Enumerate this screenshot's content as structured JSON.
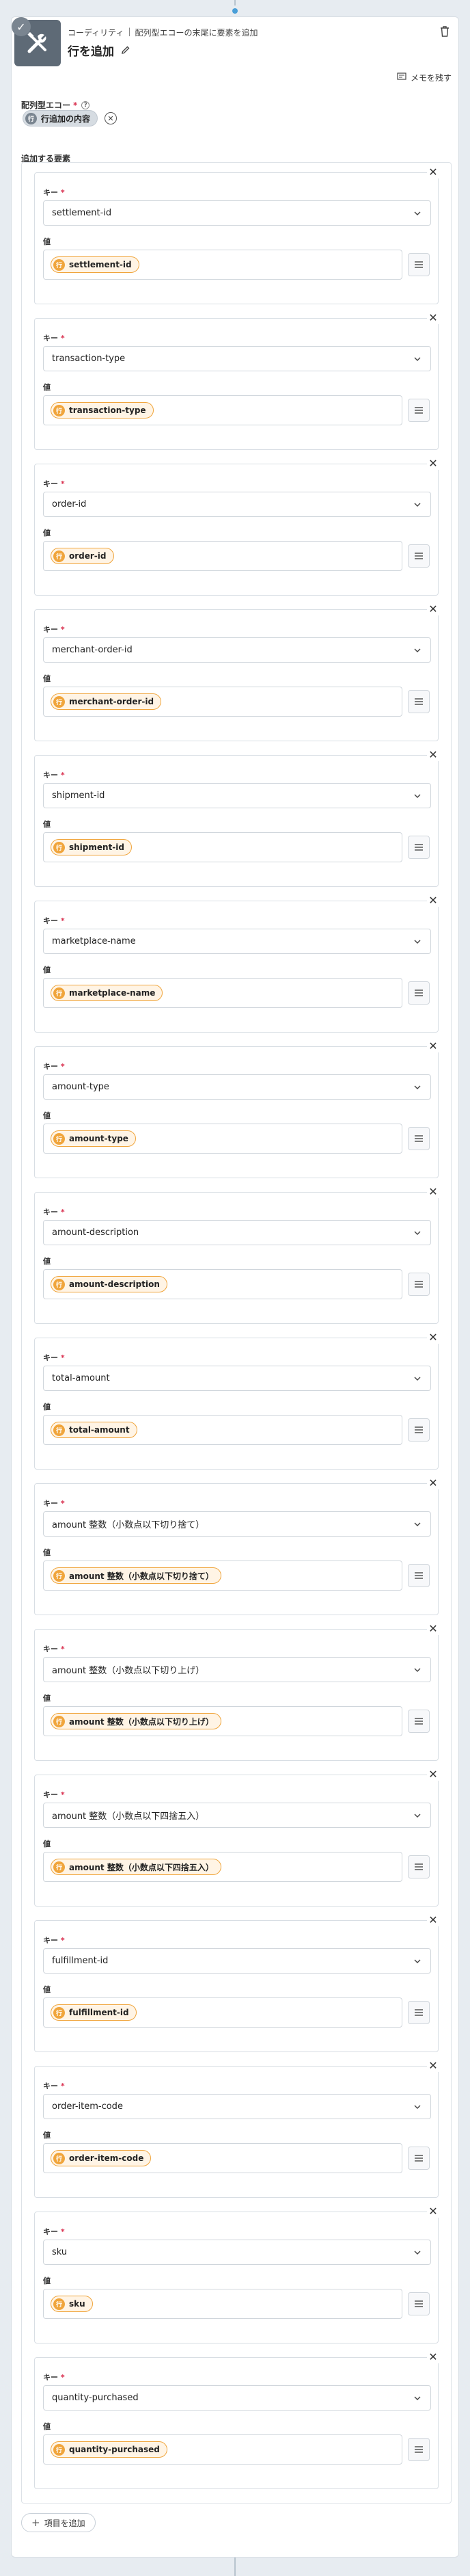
{
  "header": {
    "breadcrumb_app": "コーディリティ",
    "breadcrumb_action": "配列型エコーの末尾に要素を追加",
    "title": "行を追加",
    "memo_label": "メモを残す"
  },
  "source": {
    "label": "配列型エコー",
    "badge": "行",
    "pill": "行追加の内容"
  },
  "elements": {
    "label": "追加する要素",
    "key_label": "キー",
    "value_label": "値",
    "badge": "行",
    "items": [
      {
        "key": "settlement-id",
        "value": "settlement-id"
      },
      {
        "key": "transaction-type",
        "value": "transaction-type"
      },
      {
        "key": "order-id",
        "value": "order-id"
      },
      {
        "key": "merchant-order-id",
        "value": "merchant-order-id"
      },
      {
        "key": "shipment-id",
        "value": "shipment-id"
      },
      {
        "key": "marketplace-name",
        "value": "marketplace-name"
      },
      {
        "key": "amount-type",
        "value": "amount-type"
      },
      {
        "key": "amount-description",
        "value": "amount-description"
      },
      {
        "key": "total-amount",
        "value": "total-amount"
      },
      {
        "key": "amount 整数（小数点以下切り捨て）",
        "value": "amount 整数（小数点以下切り捨て）"
      },
      {
        "key": "amount 整数（小数点以下切り上げ）",
        "value": "amount 整数（小数点以下切り上げ）"
      },
      {
        "key": "amount 整数（小数点以下四捨五入）",
        "value": "amount 整数（小数点以下四捨五入）"
      },
      {
        "key": "fulfillment-id",
        "value": "fulfillment-id"
      },
      {
        "key": "order-item-code",
        "value": "order-item-code"
      },
      {
        "key": "sku",
        "value": "sku"
      },
      {
        "key": "quantity-purchased",
        "value": "quantity-purchased"
      }
    ]
  },
  "add_item_label": "項目を追加",
  "colors": {
    "accent": "#f0a53c",
    "header_icon": "#5e6a76",
    "connector": "#4a9fd8"
  }
}
